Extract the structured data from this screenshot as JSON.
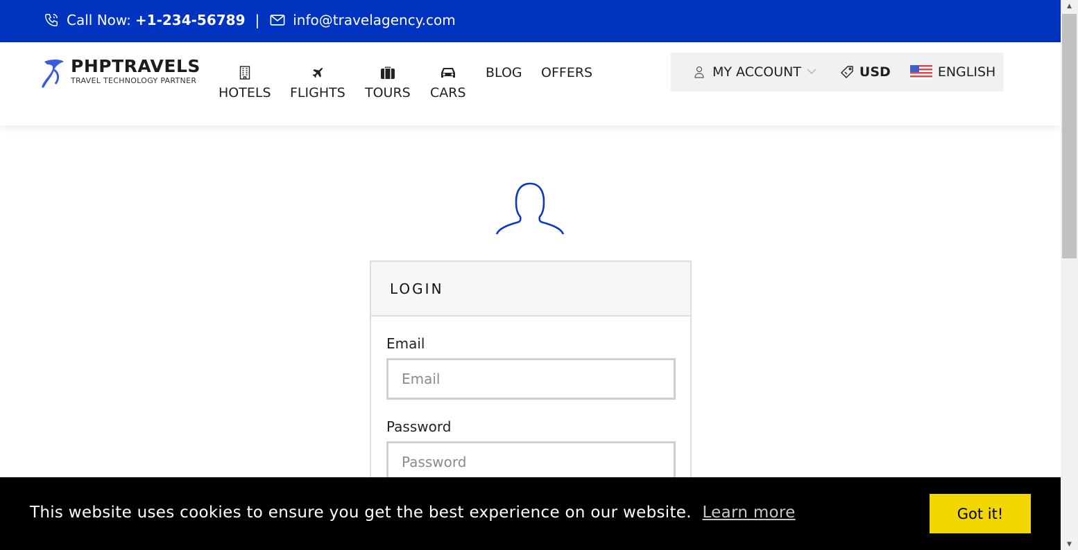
{
  "topbar": {
    "call_label": "Call Now:",
    "phone": "+1-234-56789",
    "separator": "|",
    "email": "info@travelagency.com",
    "bg_color": "#0033bf"
  },
  "logo": {
    "brand": "PHPTRAVELS",
    "tagline": "TRAVEL TECHNOLOGY PARTNER"
  },
  "nav": {
    "items": [
      {
        "label": "HOTELS",
        "icon": "building-icon"
      },
      {
        "label": "FLIGHTS",
        "icon": "airplane-icon"
      },
      {
        "label": "TOURS",
        "icon": "suitcase-icon"
      },
      {
        "label": "CARS",
        "icon": "car-icon"
      }
    ],
    "blog": "BLOG",
    "offers": "OFFERS"
  },
  "account": {
    "my_account": "MY ACCOUNT",
    "currency": "USD",
    "language": "ENGLISH"
  },
  "login": {
    "title": "LOGIN",
    "email_label": "Email",
    "email_placeholder": "Email",
    "password_label": "Password",
    "password_placeholder": "Password"
  },
  "cookie": {
    "message": "This website uses cookies to ensure you get the best experience on our website.",
    "learn_more": "Learn more",
    "button": "Got it!",
    "button_color": "#f1d600"
  }
}
